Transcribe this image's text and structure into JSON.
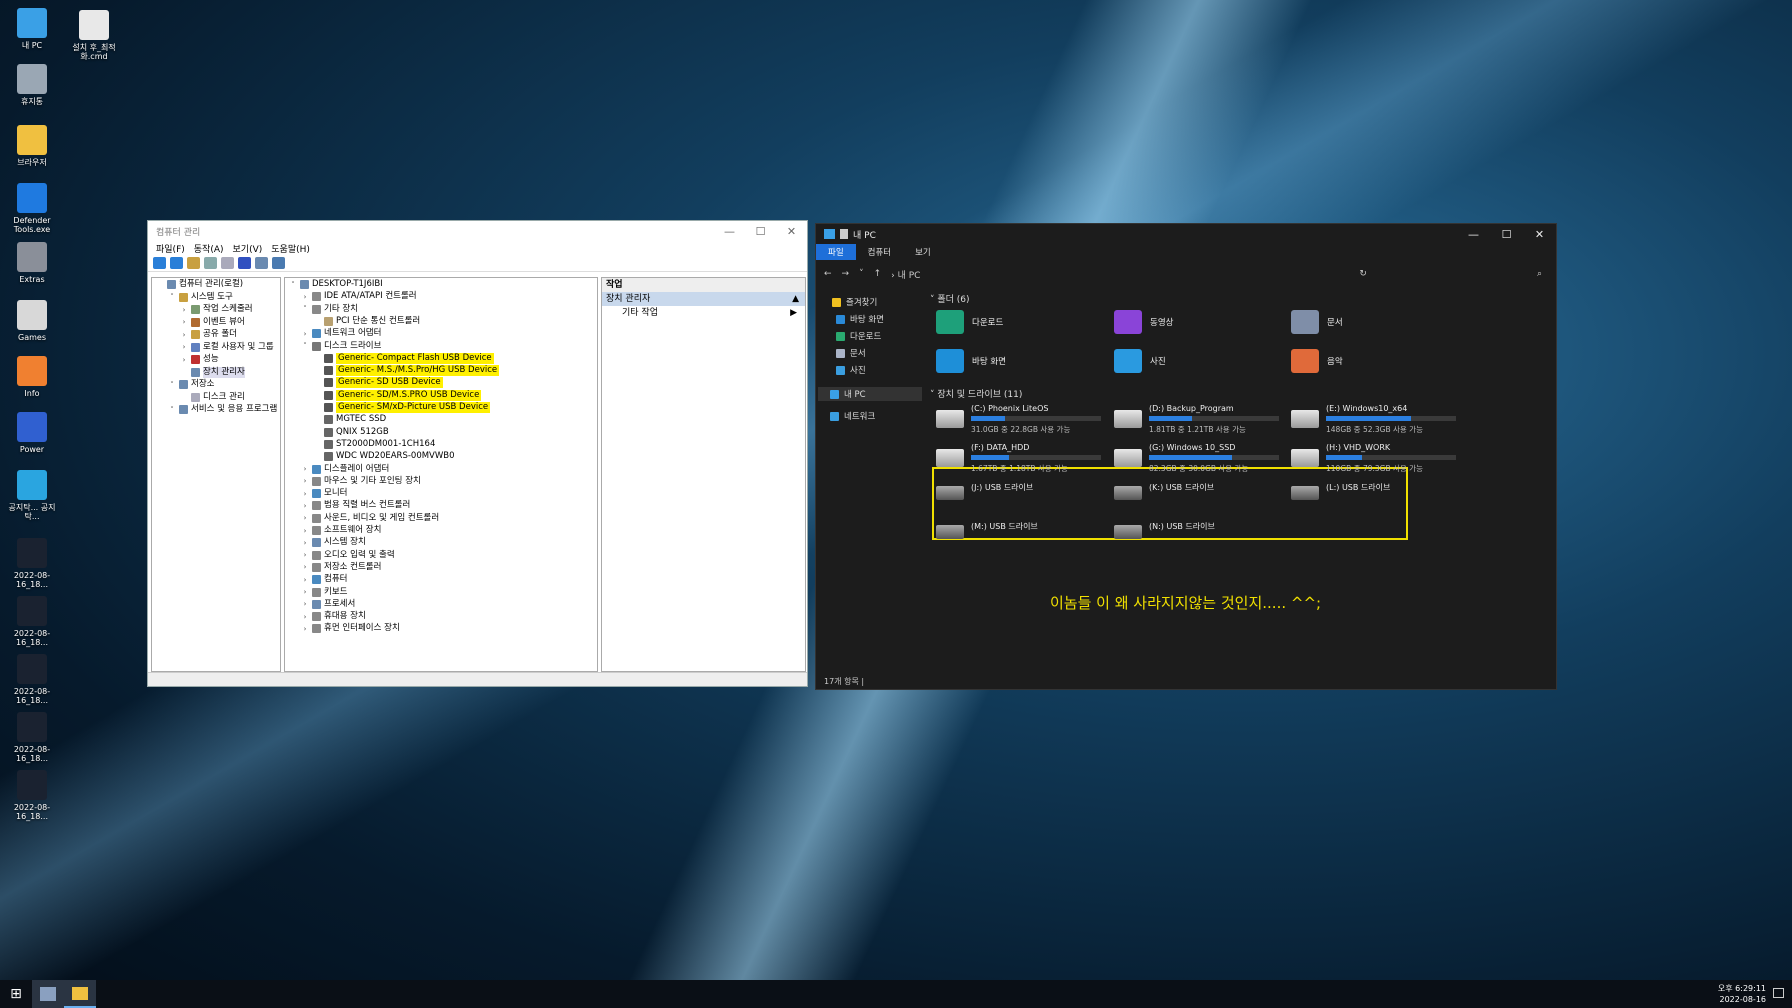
{
  "desktop": {
    "icons": [
      {
        "label": "내 PC",
        "name": "my-pc-icon",
        "color": "#3aa0e6"
      },
      {
        "label": "휴지통",
        "name": "recycle-bin-icon",
        "color": "#9aa7b4"
      },
      {
        "label": "브라우저",
        "name": "browser-icon",
        "color": "#f0c040"
      },
      {
        "label": "Defender Tools.exe",
        "name": "defender-icon",
        "color": "#1f7ae0"
      },
      {
        "label": "Extras",
        "name": "extras-icon",
        "color": "#8a8f99"
      },
      {
        "label": "Games",
        "name": "games-icon",
        "color": "#d8d8d8"
      },
      {
        "label": "Info",
        "name": "info-icon",
        "color": "#f08030"
      },
      {
        "label": "Power",
        "name": "power-icon",
        "color": "#3060d0"
      },
      {
        "label": "공지탁... 공지탁...",
        "name": "notice-icon",
        "color": "#2aa5e0"
      },
      {
        "label": "2022-08-16_18...",
        "name": "screenshot-icon",
        "color": "#1a2230"
      },
      {
        "label": "2022-08-16_18...",
        "name": "screenshot-icon",
        "color": "#1a2230"
      },
      {
        "label": "2022-08-16_18...",
        "name": "screenshot-icon",
        "color": "#1a2230"
      },
      {
        "label": "2022-08-16_18...",
        "name": "screenshot-icon",
        "color": "#1a2230"
      },
      {
        "label": "2022-08-16_18...",
        "name": "screenshot-icon",
        "color": "#1a2230"
      }
    ],
    "icon2": {
      "label": "설치 후_최적화.cmd"
    }
  },
  "cm": {
    "title": "컴퓨터 관리",
    "menu": [
      "파일(F)",
      "동작(A)",
      "보기(V)",
      "도움말(H)"
    ],
    "left_tree": [
      "컴퓨터 관리(로컬)",
      "시스템 도구",
      "작업 스케줄러",
      "이벤트 뷰어",
      "공유 폴더",
      "로컬 사용자 및 그룹",
      "성능",
      "장치 관리자",
      "저장소",
      "디스크 관리",
      "서비스 및 응용 프로그램"
    ],
    "device_root": "DESKTOP-T1J6IBI",
    "devices_top": [
      "IDE ATA/ATAPI 컨트롤러",
      "기타 장치",
      "PCI 단순 통신 컨트롤러",
      "네트워크 어댑터",
      "디스크 드라이브"
    ],
    "usb_devices": [
      "Generic- Compact Flash USB Device",
      "Generic- M.S./M.S.Pro/HG USB Device",
      "Generic- SD USB Device",
      "Generic- SD/M.S.PRO USB Device",
      "Generic- SM/xD-Picture USB Device"
    ],
    "disks": [
      "MGTEC SSD",
      "QNIX 512GB",
      "ST2000DM001-1CH164",
      "WDC WD20EARS-00MVWB0"
    ],
    "devices_bottom": [
      "디스플레이 어댑터",
      "마우스 및 기타 포인팅 장치",
      "모니터",
      "범용 직렬 버스 컨트롤러",
      "사운드, 비디오 및 게임 컨트롤러",
      "소프트웨어 장치",
      "시스템 장치",
      "오디오 입력 및 출력",
      "저장소 컨트롤러",
      "컴퓨터",
      "키보드",
      "프로세서",
      "휴대용 장치",
      "휴먼 인터페이스 장치"
    ],
    "actions_header": "작업",
    "actions_selected": "장치 관리자",
    "actions_more": "기타 작업"
  },
  "fe": {
    "title": "내 PC",
    "ribbon": [
      "파일",
      "컴퓨터",
      "보기"
    ],
    "address": "내 PC",
    "nav": [
      {
        "label": "즐겨찾기",
        "color": "#f0c020"
      },
      {
        "label": "바탕 화면",
        "color": "#2a8ad8"
      },
      {
        "label": "다운로드",
        "color": "#2aaa70"
      },
      {
        "label": "문서",
        "color": "#aab4c8"
      },
      {
        "label": "사진",
        "color": "#3a9ee0"
      },
      {
        "label": "내 PC",
        "color": "#3aa0e6"
      },
      {
        "label": "네트워크",
        "color": "#3a9ee0"
      }
    ],
    "folders_header": "폴더 (6)",
    "folders": [
      {
        "label": "다운로드",
        "color": "#1ea07a"
      },
      {
        "label": "동영상",
        "color": "#8a44d8"
      },
      {
        "label": "문서",
        "color": "#7f8ea8"
      },
      {
        "label": "바탕 화면",
        "color": "#1e8fd8"
      },
      {
        "label": "사진",
        "color": "#2a9ae0"
      },
      {
        "label": "음악",
        "color": "#e06a3a"
      }
    ],
    "drives_header": "장치 및 드라이브 (11)",
    "drives": [
      {
        "name": "(C:) Phoenix LiteOS",
        "size": "31.0GB 중 22.8GB 사용 가능",
        "used": 0.26
      },
      {
        "name": "(D:) Backup_Program",
        "size": "1.81TB 중 1.21TB 사용 가능",
        "used": 0.33
      },
      {
        "name": "(E:) Windows10_x64",
        "size": "148GB 중 52.3GB 사용 가능",
        "used": 0.65
      },
      {
        "name": "(F:) DATA_HDD",
        "size": "1.67TB 중 1.18TB 사용 가능",
        "used": 0.29
      },
      {
        "name": "(G:) Windows 10_SSD",
        "size": "82.3GB 중 30.0GB 사용 가능",
        "used": 0.64
      },
      {
        "name": "(H:) VHD_WORK",
        "size": "110GB 중 79.3GB 사용 가능",
        "used": 0.28
      }
    ],
    "usb": [
      "(J:) USB 드라이브",
      "(K:) USB 드라이브",
      "(L:) USB 드라이브",
      "(M:) USB 드라이브",
      "(N:) USB 드라이브"
    ],
    "status": "17개 항목"
  },
  "note": "이놈들 이 왜 사라지지않는 것인지..... ^^;",
  "clock": {
    "time": "오후 6:29:11",
    "date": "2022-08-16"
  }
}
